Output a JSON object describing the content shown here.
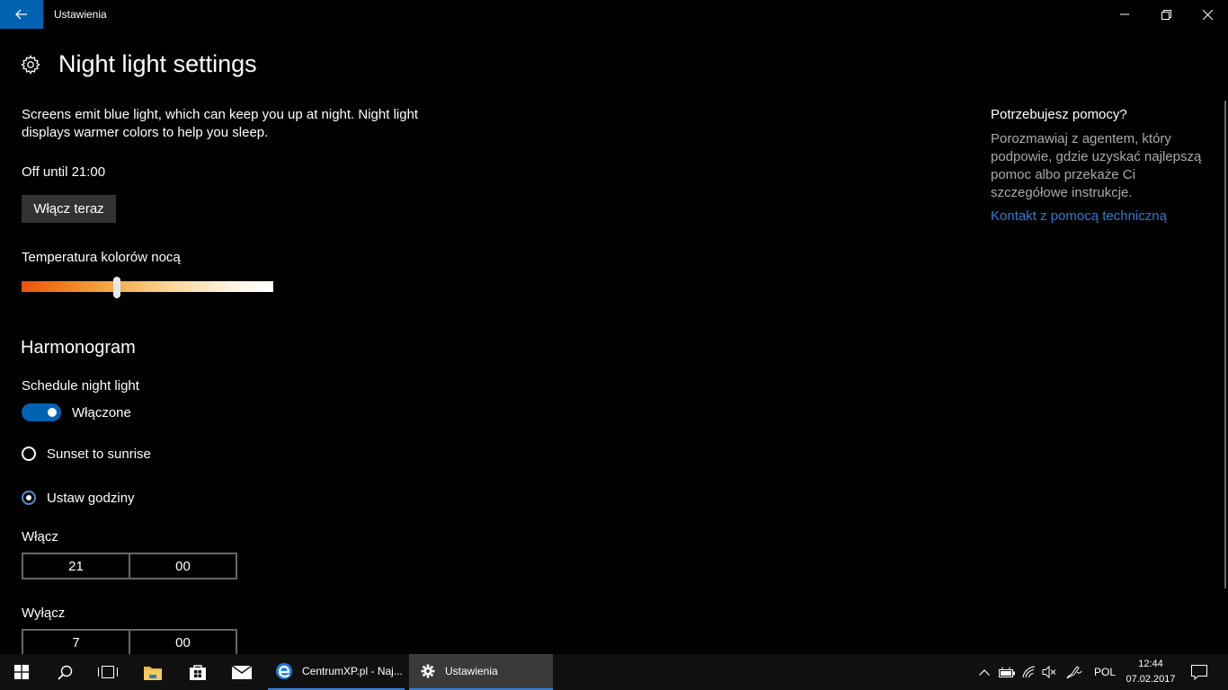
{
  "window": {
    "title": "Ustawienia"
  },
  "header": {
    "title": "Night light settings"
  },
  "main": {
    "description": "Screens emit blue light, which can keep you up at night. Night light displays warmer colors to help you sleep.",
    "status": "Off until 21:00",
    "turn_on_button": "Włącz teraz",
    "temperature_label": "Temperatura kolorów nocą",
    "temperature_level": 0.38,
    "schedule_section_title": "Harmonogram",
    "schedule_label": "Schedule night light",
    "schedule_toggle_state": "Włączone",
    "schedule_enabled": true,
    "options": [
      {
        "label": "Sunset to sunrise",
        "selected": false
      },
      {
        "label": "Ustaw godziny",
        "selected": true
      }
    ],
    "turn_on": {
      "label": "Włącz",
      "hour": "21",
      "minute": "00"
    },
    "turn_off": {
      "label": "Wyłącz",
      "hour": "7",
      "minute": "00"
    }
  },
  "help": {
    "title": "Potrzebujesz pomocy?",
    "text": "Porozmawiaj z agentem, który podpowie, gdzie uzyskać najlepszą pomoc albo przekaże Ci szczegółowe instrukcje.",
    "link": "Kontakt z pomocą techniczną"
  },
  "taskbar": {
    "edge_label": "CentrumXP.pl - Naj...",
    "settings_label": "Ustawienia",
    "language": "POL",
    "time": "12:44",
    "date": "07.02.2017"
  },
  "colors": {
    "accent": "#0063b1",
    "link": "#2b7bd6",
    "background": "#000000",
    "button_bg": "#333333"
  }
}
